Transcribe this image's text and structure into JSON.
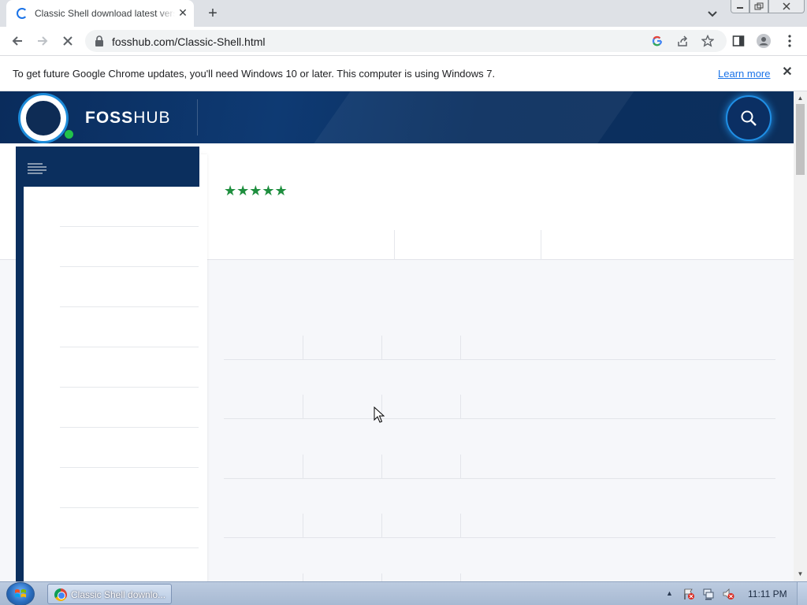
{
  "browser": {
    "tab_title": "Classic Shell download latest version",
    "url": "fosshub.com/Classic-Shell.html"
  },
  "infobar": {
    "message": "To get future Google Chrome updates, you'll need Windows 10 or later. This computer is using Windows 7.",
    "link_label": "Learn more"
  },
  "site": {
    "brand_bold": "FOSS",
    "brand_thin": "HUB",
    "rating_stars": "★★★★★",
    "rating_color": "#1e8e3e",
    "header_color": "#0b2f5e"
  },
  "taskbar": {
    "task_label": "Classic Shell downlo...",
    "clock": "11:11 PM"
  }
}
